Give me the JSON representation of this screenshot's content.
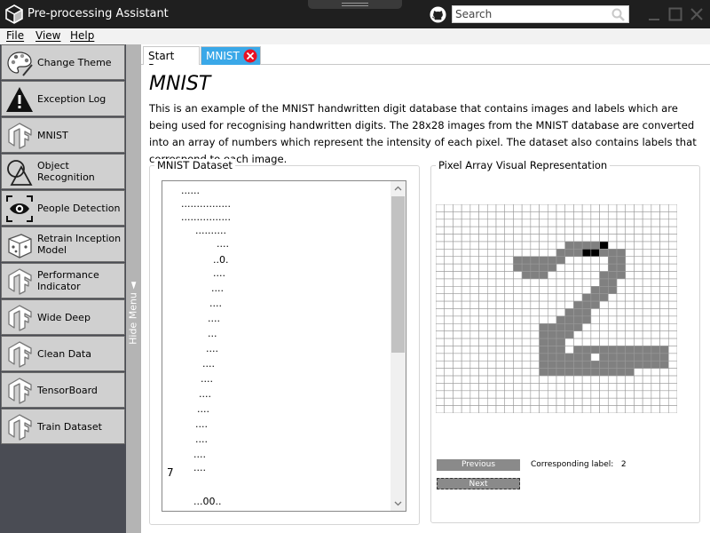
{
  "window": {
    "title": "Pre-processing Assistant",
    "search_placeholder": "Search"
  },
  "menu": {
    "file": "File",
    "view": "View",
    "help": "Help"
  },
  "sidebar": {
    "items": [
      {
        "label": "Change Theme",
        "icon": "palette-icon"
      },
      {
        "label": "Exception Log",
        "icon": "warning-icon"
      },
      {
        "label": "MNIST",
        "icon": "tensorflow-icon"
      },
      {
        "label": "Object Recognition",
        "icon": "shapes-icon"
      },
      {
        "label": "People Detection",
        "icon": "eye-icon"
      },
      {
        "label": "Retrain Inception Model",
        "icon": "box-icon"
      },
      {
        "label": "Performance Indicator",
        "icon": "tensorflow-icon"
      },
      {
        "label": "Wide Deep",
        "icon": "tensorflow-icon"
      },
      {
        "label": "Clean Data",
        "icon": "tensorflow-icon"
      },
      {
        "label": "TensorBoard",
        "icon": "tensorflow-icon"
      },
      {
        "label": "Train Dataset",
        "icon": "tensorflow-icon"
      }
    ],
    "hide_label": "Hide Menu ◄"
  },
  "tabs": {
    "start": "Start Page",
    "mnist": "MNIST"
  },
  "main": {
    "title": "MNIST",
    "description": "This is an example of the MNIST handwritten digit database that contains images and labels which are being used for recognising handwritten digits. The 28x28 images from the MNIST database are converted into an array of numbers which represent the intensity of each pixel. The dataset also contains labels that correspond to each image."
  },
  "dataset": {
    "title": "MNIST Dataset",
    "lines": [
      "......",
      "................",
      "................",
      "..........",
      "....",
      "..0.",
      "....",
      "....",
      "....",
      "....",
      "...",
      "....",
      "....",
      "....",
      "....",
      "....",
      "....",
      "....",
      "....",
      "....",
      "7",
      "...00.."
    ]
  },
  "pixels": {
    "title": "Pixel Array Visual Representation",
    "rows": [
      "............................",
      "............................",
      "............................",
      "............................",
      "............................",
      "...............GGGGD........",
      "..............GGGDDGGG......",
      ".........GGGGGG.....GG......",
      ".........GGGGG......GG......",
      "..........GGG......GGG......",
      "...................GG.......",
      "..................GGG.......",
      ".................GGG........",
      "................GGG.........",
      "...............GGG..........",
      "..............GGGG..........",
      "............GGGGG...........",
      "............GGGG............",
      "............GGG.............",
      "............GGG.GGGGGGGGGGG.",
      "............GGGGGG.GGGGGGGG.",
      "............GGGGGGGGGGGGGGG.",
      "............GGGGGGGGGGG.....",
      "............................",
      "............................",
      "............................",
      "............................",
      "............................"
    ],
    "gray": "#808080",
    "dark": "#000000",
    "previous": "Previous",
    "next": "Next",
    "label_caption": "Corresponding label:",
    "label_value": "2"
  },
  "colors": {
    "accent": "#3aa8e8",
    "close": "#e81123"
  }
}
